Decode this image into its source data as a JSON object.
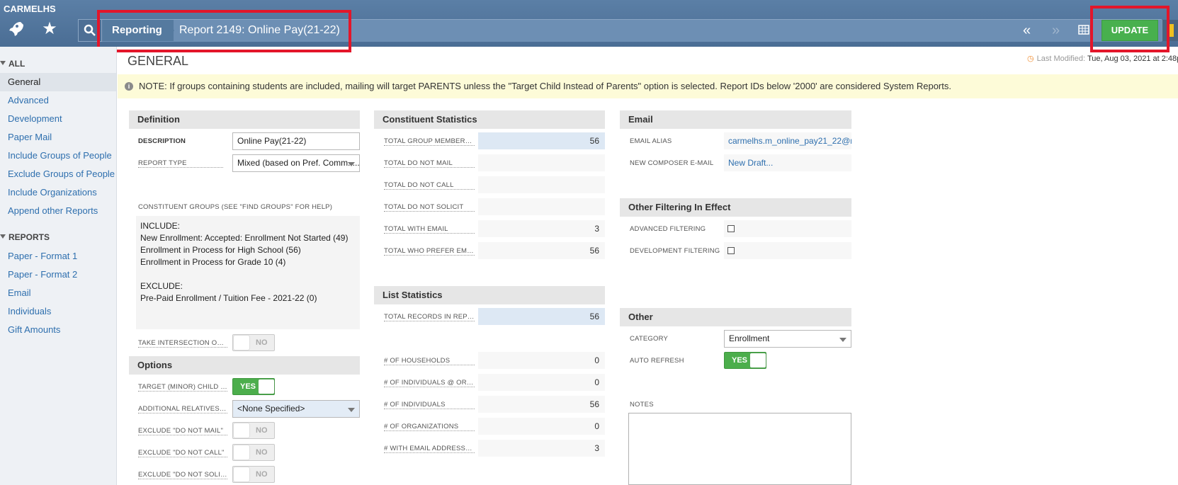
{
  "app": {
    "brand": "CARMELHS"
  },
  "header": {
    "breadcrumb_root": "Reporting",
    "breadcrumb_title": "Report 2149: Online Pay(21-22)",
    "update_label": "UPDATE"
  },
  "sidebar": {
    "section_all": "ALL",
    "items_all": [
      "General",
      "Advanced",
      "Development",
      "Paper Mail",
      "Include Groups of People",
      "Exclude Groups of People",
      "Include Organizations",
      "Append other Reports"
    ],
    "section_reports": "REPORTS",
    "items_reports": [
      "Paper - Format 1",
      "Paper - Format 2",
      "Email",
      "Individuals",
      "Gift Amounts"
    ]
  },
  "main": {
    "title": "GENERAL",
    "last_modified_label": "Last Modified:",
    "last_modified_value": "Tue, Aug 03, 2021 at 2:48p",
    "note": "NOTE: If groups containing students are included, mailing will target PARENTS unless the \"Target Child Instead of Parents\" option is selected. Report IDs below '2000' are considered System Reports."
  },
  "definition": {
    "heading": "Definition",
    "description_label": "DESCRIPTION",
    "description_value": "Online Pay(21-22)",
    "report_type_label": "REPORT TYPE",
    "report_type_value": "Mixed (based on Pref. Comm. ...",
    "groups_label": "CONSTITUENT GROUPS (SEE \"FIND GROUPS\" FOR HELP)",
    "groups_lines": [
      "INCLUDE:",
      "New Enrollment: Accepted: Enrollment Not Started (49)",
      "Enrollment in Process for High School (56)",
      "Enrollment in Process for Grade 10 (4)",
      "",
      "EXCLUDE:",
      "Pre-Paid Enrollment / Tuition Fee - 2021-22 (0)"
    ],
    "intersection_label": "TAKE INTERSECTION OF ...",
    "intersection_value": "NO"
  },
  "options": {
    "heading": "Options",
    "target_child_label": "TARGET (MINOR) CHILD I...",
    "target_child_value": "YES",
    "additional_relatives_label": "ADDITIONAL RELATIVES T...",
    "additional_relatives_value": "<None Specified>",
    "exclude_mail_label": "EXCLUDE \"DO NOT MAIL\"",
    "exclude_mail_value": "NO",
    "exclude_call_label": "EXCLUDE \"DO NOT CALL\"",
    "exclude_call_value": "NO",
    "exclude_solicit_label": "EXCLUDE \"DO NOT SOLIC...",
    "exclude_solicit_value": "NO"
  },
  "constituent_stats": {
    "heading": "Constituent Statistics",
    "rows": [
      {
        "label": "TOTAL GROUP MEMBERS...",
        "value": "56"
      },
      {
        "label": "TOTAL DO NOT MAIL",
        "value": ""
      },
      {
        "label": "TOTAL DO NOT CALL",
        "value": ""
      },
      {
        "label": "TOTAL DO NOT SOLICIT",
        "value": ""
      },
      {
        "label": "TOTAL WITH EMAIL",
        "value": "3"
      },
      {
        "label": "TOTAL WHO PREFER EMAIL",
        "value": "56"
      }
    ]
  },
  "list_stats": {
    "heading": "List Statistics",
    "records_label": "TOTAL RECORDS IN REPO...",
    "records_value": "56",
    "rows": [
      {
        "label": "# OF HOUSEHOLDS",
        "value": "0"
      },
      {
        "label": "# OF INDIVIDUALS @ ORG...",
        "value": "0"
      },
      {
        "label": "# OF INDIVIDUALS",
        "value": "56"
      },
      {
        "label": "# OF ORGANIZATIONS",
        "value": "0"
      },
      {
        "label": "# WITH EMAIL ADDRESSES",
        "value": "3"
      }
    ]
  },
  "email": {
    "heading": "Email",
    "alias_label": "EMAIL ALIAS",
    "alias_value": "carmelhs.m_online_pay21_22@r",
    "composer_label": "NEW COMPOSER E-MAIL",
    "composer_value": "New Draft..."
  },
  "filtering": {
    "heading": "Other Filtering In Effect",
    "advanced_label": "ADVANCED FILTERING",
    "development_label": "DEVELOPMENT FILTERING"
  },
  "other": {
    "heading": "Other",
    "category_label": "CATEGORY",
    "category_value": "Enrollment",
    "auto_refresh_label": "AUTO REFRESH",
    "auto_refresh_value": "YES",
    "notes_label": "NOTES"
  }
}
